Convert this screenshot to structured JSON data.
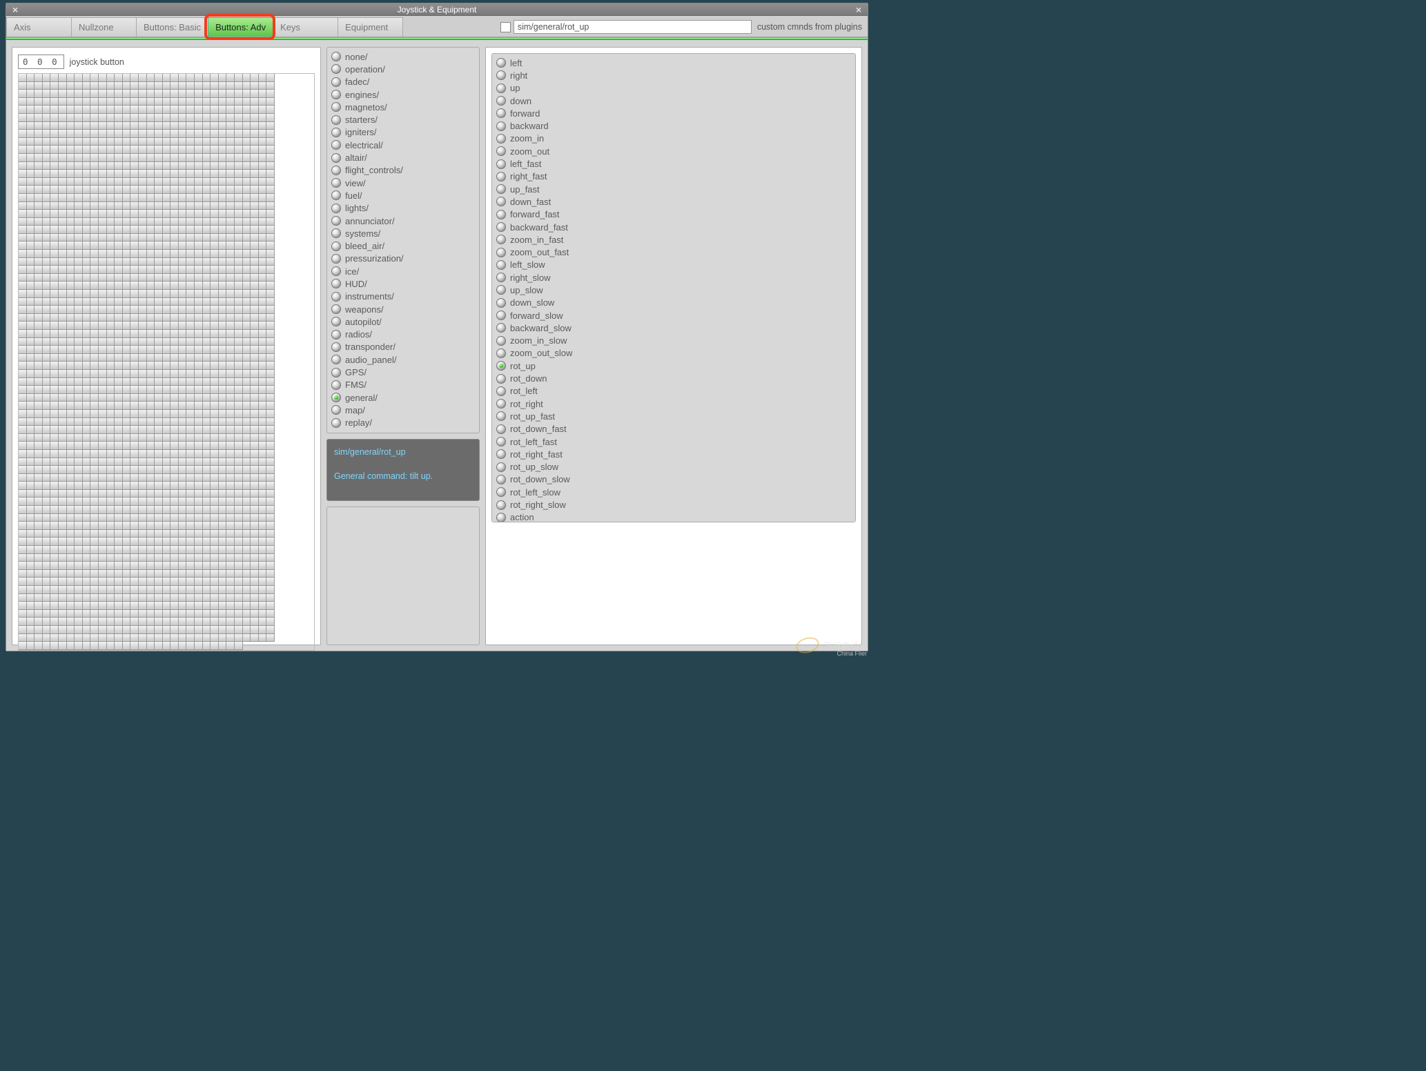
{
  "window": {
    "title": "Joystick & Equipment"
  },
  "tabs": {
    "items": [
      "Axis",
      "Nullzone",
      "Buttons: Basic",
      "Buttons: Adv",
      "Keys",
      "Equipment"
    ],
    "activeIndex": 3
  },
  "command_row": {
    "path": "sim/general/rot_up",
    "label": "custom cmnds from plugins"
  },
  "left": {
    "button_number": "0 0 0",
    "label": "joystick button",
    "grid_cols": 32,
    "grid_rows_full": 64,
    "top_extra_cols": 4,
    "top_extra_rows": 7
  },
  "categories": {
    "selectedIndex": 27,
    "items": [
      "none/",
      "operation/",
      "fadec/",
      "engines/",
      "magnetos/",
      "starters/",
      "igniters/",
      "electrical/",
      "altair/",
      "flight_controls/",
      "view/",
      "fuel/",
      "lights/",
      "annunciator/",
      "systems/",
      "bleed_air/",
      "pressurization/",
      "ice/",
      "HUD/",
      "instruments/",
      "weapons/",
      "autopilot/",
      "radios/",
      "transponder/",
      "audio_panel/",
      "GPS/",
      "FMS/",
      "general/",
      "map/",
      "replay/"
    ]
  },
  "desc": {
    "path": "sim/general/rot_up",
    "text": "General command: tilt up."
  },
  "actions": {
    "selectedIndex": 24,
    "items": [
      "left",
      "right",
      "up",
      "down",
      "forward",
      "backward",
      "zoom_in",
      "zoom_out",
      "left_fast",
      "right_fast",
      "up_fast",
      "down_fast",
      "forward_fast",
      "backward_fast",
      "zoom_in_fast",
      "zoom_out_fast",
      "left_slow",
      "right_slow",
      "up_slow",
      "down_slow",
      "forward_slow",
      "backward_slow",
      "zoom_in_slow",
      "zoom_out_slow",
      "rot_up",
      "rot_down",
      "rot_left",
      "rot_right",
      "rot_up_fast",
      "rot_down_fast",
      "rot_left_fast",
      "rot_right_fast",
      "rot_up_slow",
      "rot_down_slow",
      "rot_left_slow",
      "rot_right_slow",
      "action"
    ]
  },
  "watermark": {
    "text": "飞行者论坛",
    "sub": "China Flier"
  }
}
